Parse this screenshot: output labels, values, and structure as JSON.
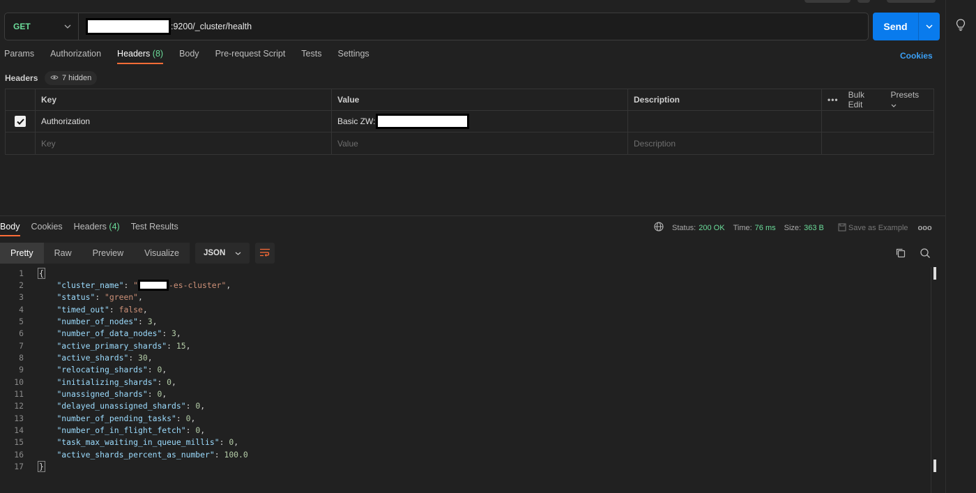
{
  "request": {
    "method": "GET",
    "url_suffix": ":9200/_cluster/health",
    "send_label": "Send"
  },
  "req_tabs": [
    {
      "label": "Params"
    },
    {
      "label": "Authorization"
    },
    {
      "label": "Headers",
      "count": "(8)",
      "active": true
    },
    {
      "label": "Body"
    },
    {
      "label": "Pre-request Script"
    },
    {
      "label": "Tests"
    },
    {
      "label": "Settings"
    }
  ],
  "cookies_label": "Cookies",
  "headers_section": {
    "title": "Headers",
    "hidden_label": "7 hidden",
    "columns": {
      "key": "Key",
      "value": "Value",
      "description": "Description"
    },
    "bulk_edit": "Bulk Edit",
    "presets": "Presets",
    "rows": [
      {
        "key": "Authorization",
        "value_prefix": "Basic ZW:",
        "checked": true
      }
    ],
    "placeholder": {
      "key": "Key",
      "value": "Value",
      "description": "Description"
    }
  },
  "resp_tabs": [
    {
      "label": "Body",
      "active": true
    },
    {
      "label": "Cookies"
    },
    {
      "label": "Headers",
      "count": "(4)"
    },
    {
      "label": "Test Results"
    }
  ],
  "response_meta": {
    "status_label": "Status:",
    "status_value": "200 OK",
    "time_label": "Time:",
    "time_value": "76 ms",
    "size_label": "Size:",
    "size_value": "363 B",
    "save_label": "Save as Example",
    "more": "ooo"
  },
  "view_modes": [
    "Pretty",
    "Raw",
    "Preview",
    "Visualize"
  ],
  "format": "JSON",
  "body_lines": [
    {
      "n": "1",
      "type": "open"
    },
    {
      "n": "2",
      "key": "\"cluster_name\"",
      "redacted": true,
      "val": "-es-cluster\"",
      "vtype": "str",
      "comma": true
    },
    {
      "n": "3",
      "key": "\"status\"",
      "val": "\"green\"",
      "vtype": "str",
      "comma": true
    },
    {
      "n": "4",
      "key": "\"timed_out\"",
      "val": "false",
      "vtype": "bool",
      "comma": true
    },
    {
      "n": "5",
      "key": "\"number_of_nodes\"",
      "val": "3",
      "vtype": "num",
      "comma": true
    },
    {
      "n": "6",
      "key": "\"number_of_data_nodes\"",
      "val": "3",
      "vtype": "num",
      "comma": true
    },
    {
      "n": "7",
      "key": "\"active_primary_shards\"",
      "val": "15",
      "vtype": "num",
      "comma": true
    },
    {
      "n": "8",
      "key": "\"active_shards\"",
      "val": "30",
      "vtype": "num",
      "comma": true
    },
    {
      "n": "9",
      "key": "\"relocating_shards\"",
      "val": "0",
      "vtype": "num",
      "comma": true
    },
    {
      "n": "10",
      "key": "\"initializing_shards\"",
      "val": "0",
      "vtype": "num",
      "comma": true
    },
    {
      "n": "11",
      "key": "\"unassigned_shards\"",
      "val": "0",
      "vtype": "num",
      "comma": true
    },
    {
      "n": "12",
      "key": "\"delayed_unassigned_shards\"",
      "val": "0",
      "vtype": "num",
      "comma": true
    },
    {
      "n": "13",
      "key": "\"number_of_pending_tasks\"",
      "val": "0",
      "vtype": "num",
      "comma": true
    },
    {
      "n": "14",
      "key": "\"number_of_in_flight_fetch\"",
      "val": "0",
      "vtype": "num",
      "comma": true
    },
    {
      "n": "15",
      "key": "\"task_max_waiting_in_queue_millis\"",
      "val": "0",
      "vtype": "num",
      "comma": true
    },
    {
      "n": "16",
      "key": "\"active_shards_percent_as_number\"",
      "val": "100.0",
      "vtype": "num",
      "comma": false
    },
    {
      "n": "17",
      "type": "close"
    }
  ]
}
